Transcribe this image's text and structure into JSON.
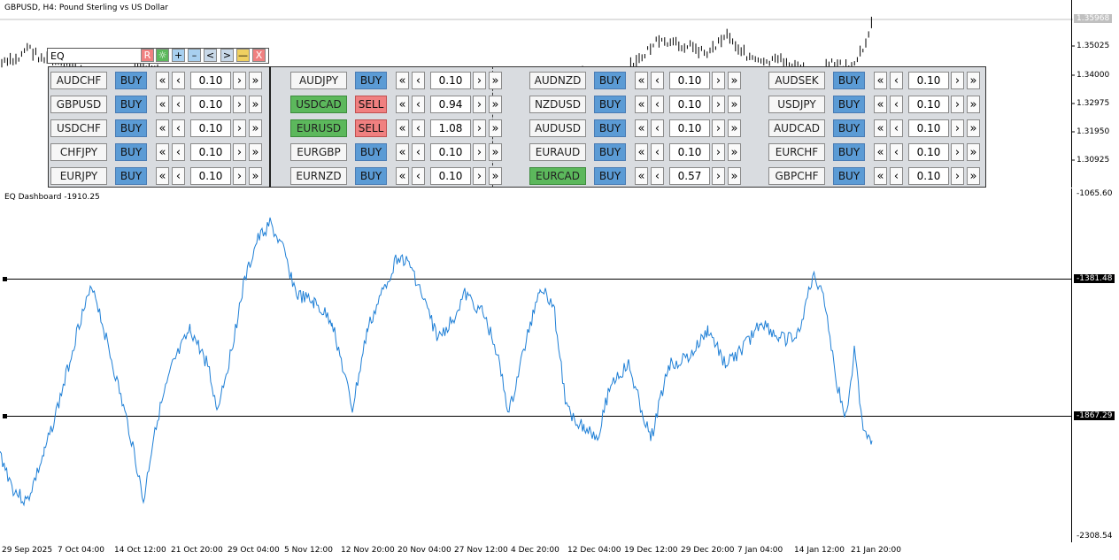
{
  "window_title": "GBPUSD, H4:  Pound Sterling vs US Dollar",
  "main_chart": {
    "current_price": "1.35968",
    "price_ticks": [
      "1.35025",
      "1.34000",
      "1.32975",
      "1.31950",
      "1.30925"
    ]
  },
  "indicator": {
    "title": "EQ Dashboard -1910.25",
    "scale_ticks": [
      "-1065.60",
      "-2308.54"
    ],
    "levels": [
      "-1381.48",
      "-1867.29"
    ]
  },
  "time_axis": [
    "29 Sep 2025",
    "7 Oct 04:00",
    "14 Oct 12:00",
    "21 Oct 20:00",
    "29 Oct 04:00",
    "5 Nov 12:00",
    "12 Nov 20:00",
    "20 Nov 04:00",
    "27 Nov 12:00",
    "4 Dec 20:00",
    "12 Dec 04:00",
    "19 Dec 12:00",
    "29 Dec 20:00",
    "7 Jan 04:00",
    "14 Jan 12:00",
    "21 Jan 20:00"
  ],
  "dashboard": {
    "title": "EQ",
    "toolbar": [
      "R",
      "☼",
      "+",
      "–",
      "<",
      ">",
      "—",
      "X"
    ],
    "nav_labels": {
      "first": "«",
      "prev": "‹",
      "next": "›",
      "last": "»"
    },
    "columns": [
      {
        "rows": [
          {
            "symbol": "AUDCHF",
            "action": "BUY",
            "lot": "0.10"
          },
          {
            "symbol": "GBPUSD",
            "action": "BUY",
            "lot": "0.10"
          },
          {
            "symbol": "USDCHF",
            "action": "BUY",
            "lot": "0.10"
          },
          {
            "symbol": "CHFJPY",
            "action": "BUY",
            "lot": "0.10"
          },
          {
            "symbol": "EURJPY",
            "action": "BUY",
            "lot": "0.10"
          }
        ]
      },
      {
        "rows": [
          {
            "symbol": "AUDJPY",
            "action": "BUY",
            "lot": "0.10"
          },
          {
            "symbol": "USDCAD",
            "action": "SELL",
            "lot": "0.94",
            "highlight": true
          },
          {
            "symbol": "EURUSD",
            "action": "SELL",
            "lot": "1.08",
            "highlight": true
          },
          {
            "symbol": "EURGBP",
            "action": "BUY",
            "lot": "0.10"
          },
          {
            "symbol": "EURNZD",
            "action": "BUY",
            "lot": "0.10"
          }
        ]
      },
      {
        "rows": [
          {
            "symbol": "AUDNZD",
            "action": "BUY",
            "lot": "0.10"
          },
          {
            "symbol": "NZDUSD",
            "action": "BUY",
            "lot": "0.10"
          },
          {
            "symbol": "AUDUSD",
            "action": "BUY",
            "lot": "0.10"
          },
          {
            "symbol": "EURAUD",
            "action": "BUY",
            "lot": "0.10"
          },
          {
            "symbol": "EURCAD",
            "action": "BUY",
            "lot": "0.57",
            "highlight": true
          }
        ]
      },
      {
        "rows": [
          {
            "symbol": "AUDSEK",
            "action": "BUY",
            "lot": "0.10"
          },
          {
            "symbol": "USDJPY",
            "action": "BUY",
            "lot": "0.10"
          },
          {
            "symbol": "AUDCAD",
            "action": "BUY",
            "lot": "0.10"
          },
          {
            "symbol": "EURCHF",
            "action": "BUY",
            "lot": "0.10"
          },
          {
            "symbol": "GBPCHF",
            "action": "BUY",
            "lot": "0.10"
          }
        ]
      }
    ]
  },
  "colors": {
    "buy": "#5b9bd5",
    "sell": "#f08080",
    "highlight": "#5cb85c",
    "equity_line": "#1e7fd6",
    "toolbar": [
      "#f08080",
      "#5cb85c",
      "#a8d0f0",
      "#a8d0f0",
      "#c8d8e8",
      "#c8d8e8",
      "#f0d060",
      "#f08080"
    ]
  }
}
